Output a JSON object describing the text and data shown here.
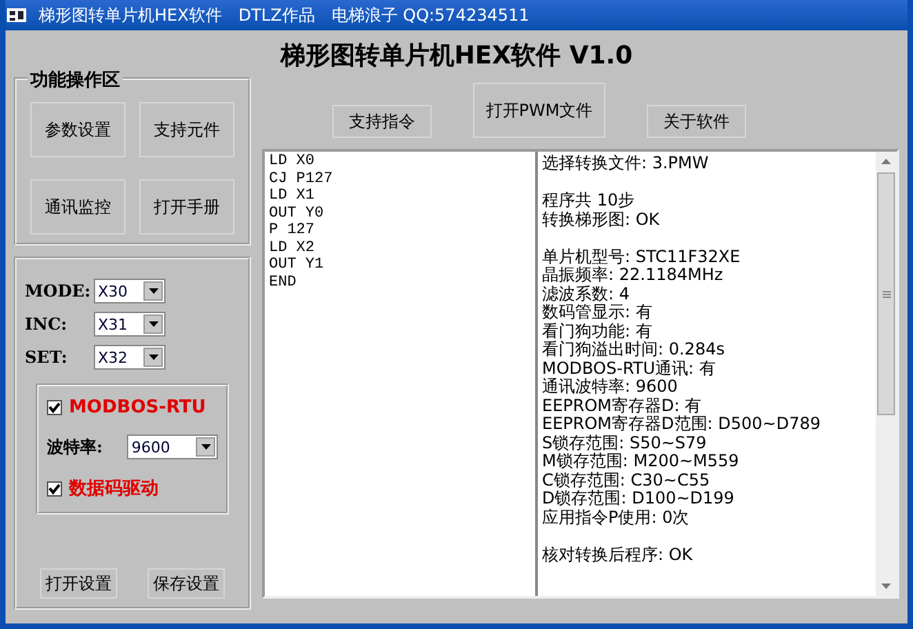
{
  "window": {
    "title": "梯形图转单片机HEX软件　DTLZ作品　电梯浪子 QQ:574234511"
  },
  "heading": "梯形图转单片机HEX软件 V1.0",
  "function_group": {
    "title": "功能操作区",
    "buttons": [
      "参数设置",
      "支持元件",
      "通讯监控",
      "打开手册"
    ]
  },
  "settings": {
    "selects": [
      {
        "label": "MODE:",
        "value": "X30"
      },
      {
        "label": "INC:",
        "value": "X31"
      },
      {
        "label": "SET:",
        "value": "X32"
      }
    ],
    "modbus": {
      "label": "MODBOS-RTU",
      "checked": true
    },
    "baud": {
      "label": "波特率:",
      "value": "9600"
    },
    "digit_drive": {
      "label": "数据码驱动",
      "checked": true
    },
    "buttons": [
      "打开设置",
      "保存设置"
    ]
  },
  "toolbar": [
    {
      "label": "支持指令",
      "kind": "small"
    },
    {
      "label": "打开PWM文件",
      "kind": "tall"
    },
    {
      "label": "关于软件",
      "kind": "small"
    }
  ],
  "program_listing": [
    "LD X0",
    "CJ P127",
    "LD X1",
    "OUT Y0",
    "P 127",
    "LD X2",
    "OUT Y1",
    "END"
  ],
  "result_log": [
    [
      "选择转换文件: 3.PMW"
    ],
    [
      "程序共 10步",
      "转换梯形图: OK"
    ],
    [
      "单片机型号: STC11F32XE",
      "晶振频率: 22.1184MHz",
      "滤波系数: 4",
      "数码管显示: 有",
      "看门狗功能: 有",
      "看门狗溢出时间: 0.284s",
      "MODBOS-RTU通讯: 有",
      "通讯波特率: 9600",
      "EEPROM寄存器D: 有",
      "EEPROM寄存器D范围: D500~D789",
      "S锁存范围: S50~S79",
      "M锁存范围: M200~M559",
      "C锁存范围: C30~C55",
      "D锁存范围: D100~D199",
      "应用指令P使用: 0次"
    ],
    [
      "核对转换后程序: OK"
    ]
  ]
}
